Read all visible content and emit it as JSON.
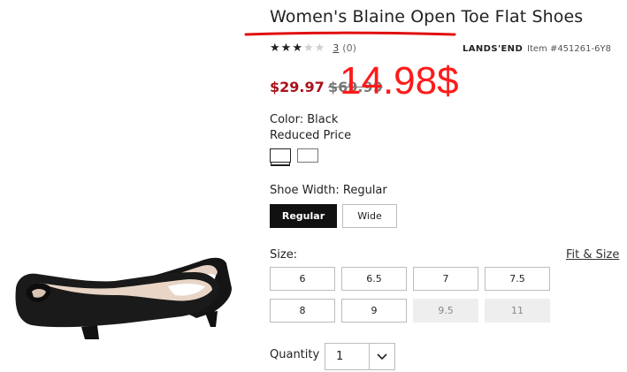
{
  "product": {
    "title": "Women's Blaine Open Toe Flat Shoes",
    "rating": {
      "stars_filled": 3,
      "stars_total": 5,
      "value_text": "3",
      "count_text": "(0)"
    },
    "brand": "LANDS'END",
    "item_number": "Item #451261-6Y8"
  },
  "pricing": {
    "sale_price": "$29.97",
    "original_price": "$69.99",
    "annotation": "14.98$"
  },
  "color": {
    "label": "Color:",
    "value": "Black",
    "note": "Reduced Price",
    "swatches": [
      "black-swatch",
      "alternate-swatch"
    ]
  },
  "width": {
    "label": "Shoe Width:",
    "value": "Regular",
    "options": [
      {
        "label": "Regular",
        "selected": true
      },
      {
        "label": "Wide",
        "selected": false
      }
    ]
  },
  "size": {
    "label": "Size:",
    "fit_link": "Fit & Size",
    "options": [
      {
        "label": "6",
        "available": true
      },
      {
        "label": "6.5",
        "available": true
      },
      {
        "label": "7",
        "available": true
      },
      {
        "label": "7.5",
        "available": true
      },
      {
        "label": "8",
        "available": true
      },
      {
        "label": "9",
        "available": true
      },
      {
        "label": "9.5",
        "available": false
      },
      {
        "label": "11",
        "available": false
      }
    ]
  },
  "quantity": {
    "label": "Quantity",
    "value": "1",
    "icon": "chevron-down-icon"
  },
  "colors": {
    "sale_red": "#a8121c",
    "annotation_red": "#ff1a1a",
    "selected_black": "#111111",
    "unavailable_gray": "#eeeeee"
  }
}
